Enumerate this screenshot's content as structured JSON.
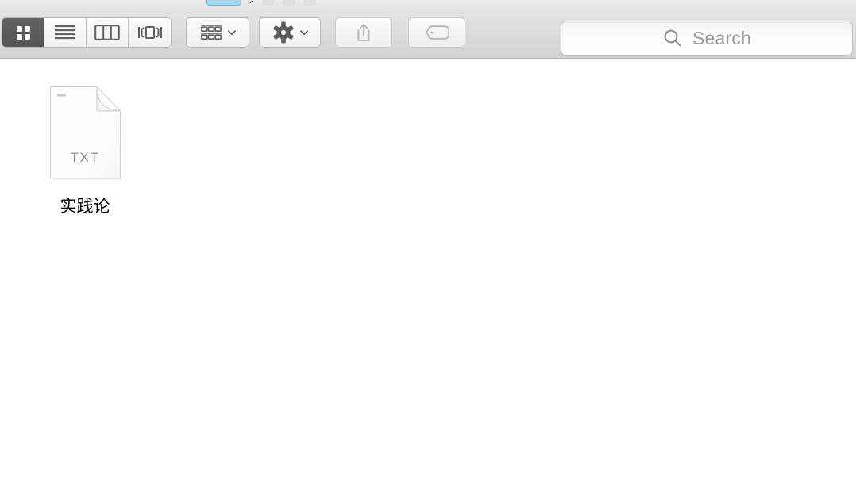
{
  "window": {
    "app": "Finder",
    "view_mode": "icon"
  },
  "top_strip": {
    "selected_pill_color": "#a9d5ea",
    "glyph": "⌄"
  },
  "toolbar": {
    "view_segments": [
      {
        "name": "icon-view",
        "label": "Icon View",
        "selected": true
      },
      {
        "name": "list-view",
        "label": "List View",
        "selected": false
      },
      {
        "name": "column-view",
        "label": "Column View",
        "selected": false
      },
      {
        "name": "gallery-view",
        "label": "Gallery View",
        "selected": false
      }
    ],
    "arrange": {
      "label": "Arrange By",
      "icon": "arrange-icon"
    },
    "action": {
      "label": "Action",
      "icon": "gear-icon"
    },
    "share": {
      "label": "Share",
      "icon": "share-icon",
      "enabled": false
    },
    "tag": {
      "label": "Tags",
      "icon": "tag-icon",
      "enabled": false
    },
    "selected_segment_color": "#5a5a5a",
    "background_color": "#dcdcdc"
  },
  "search": {
    "placeholder": "Search",
    "value": "",
    "icon": "search-icon"
  },
  "files": [
    {
      "name": "实践论",
      "kind": "TXT",
      "badge": "TXT",
      "selected": false
    }
  ]
}
